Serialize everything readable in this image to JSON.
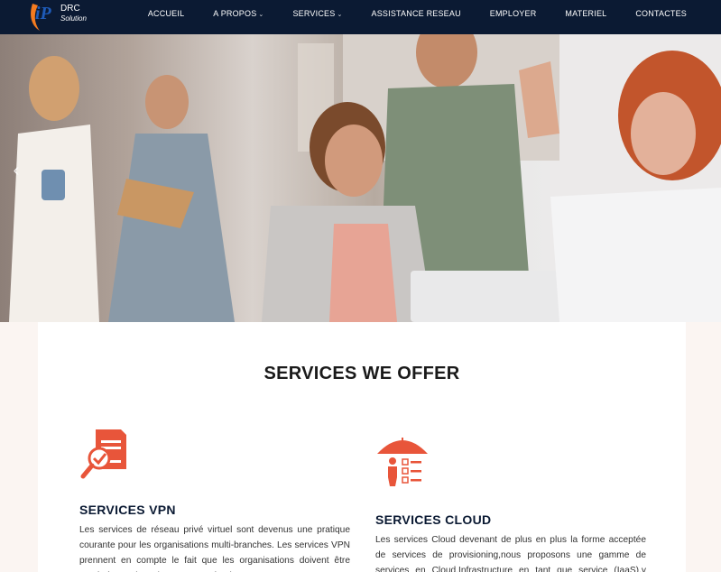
{
  "brand": {
    "line1": "DRC",
    "line2": "Solution",
    "accent": "#f47b20",
    "mark_color": "#1e5bb8"
  },
  "nav": {
    "items": [
      {
        "label": "ACCUEIL",
        "has_dropdown": false
      },
      {
        "label": "A PROPOS",
        "has_dropdown": true
      },
      {
        "label": "SERVICES",
        "has_dropdown": true
      },
      {
        "label": "ASSISTANCE RESEAU",
        "has_dropdown": false
      },
      {
        "label": "EMPLOYER",
        "has_dropdown": false
      },
      {
        "label": "MATERIEL",
        "has_dropdown": false
      },
      {
        "label": "CONTACTES",
        "has_dropdown": false
      }
    ],
    "background": "#0b1a33"
  },
  "hero": {
    "prev_icon": "chevron-left-icon"
  },
  "main": {
    "title": "SERVICES WE OFFER",
    "services": [
      {
        "icon": "document-search-icon",
        "title": "SERVICES VPN",
        "text": "Les services de réseau privé virtuel sont devenus une pratique courante pour les organisations multi-branches. Les services VPN prennent en compte le fait que les organisations doivent être protégées mais toujours connectées les unes aux autres."
      },
      {
        "icon": "umbrella-person-checklist-icon",
        "title": "SERVICES CLOUD",
        "text": "Les services Cloud devenant de plus en plus la forme acceptée de services de provisioning,nous proposons une gamme de services en Cloud.Infrastructure en tant que service (IaaS),y compris les machines virtuelles."
      }
    ],
    "icon_color": "#e8553a"
  }
}
